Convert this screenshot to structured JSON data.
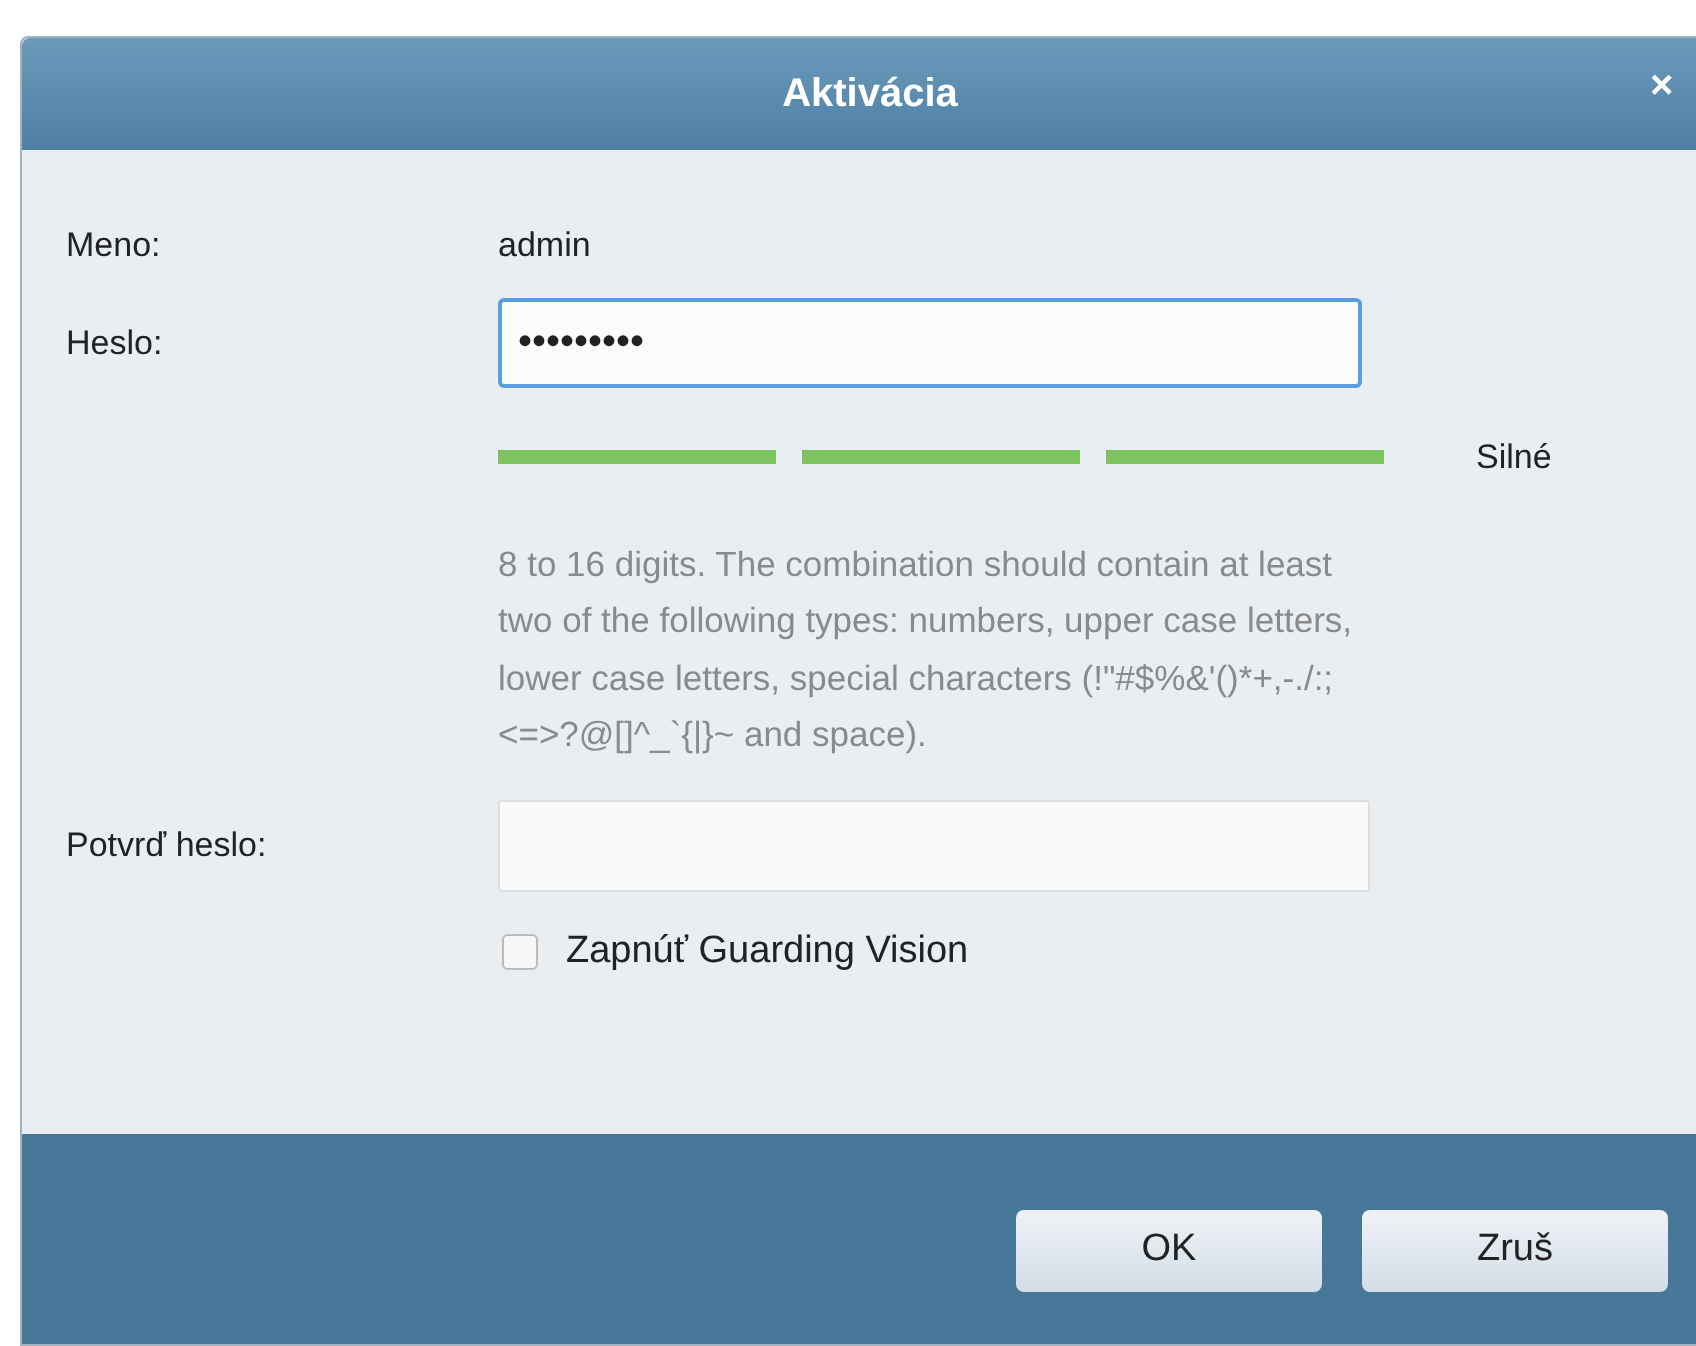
{
  "window": {
    "title": "Aktivácia",
    "close": "×"
  },
  "username": {
    "label": "Meno:",
    "value": "admin"
  },
  "password": {
    "label": "Heslo:",
    "value": "•••••••••",
    "focused": true
  },
  "strength": {
    "segments": [
      {
        "on": true
      },
      {
        "on": true
      },
      {
        "on": true
      }
    ],
    "label": "Silné"
  },
  "hint": "8 to 16 digits. The combination should contain at least two of the following types: numbers, upper case letters, lower case letters, special characters (!\"#$%&'()*+,-./:;<=>?@[]^_`{|}~ and space).",
  "confirm": {
    "label": "Potvrď heslo:"
  },
  "guarding": {
    "label": "Zapnúť Guarding Vision",
    "checked": false
  },
  "buttons": [
    "OK",
    "Zruš"
  ]
}
